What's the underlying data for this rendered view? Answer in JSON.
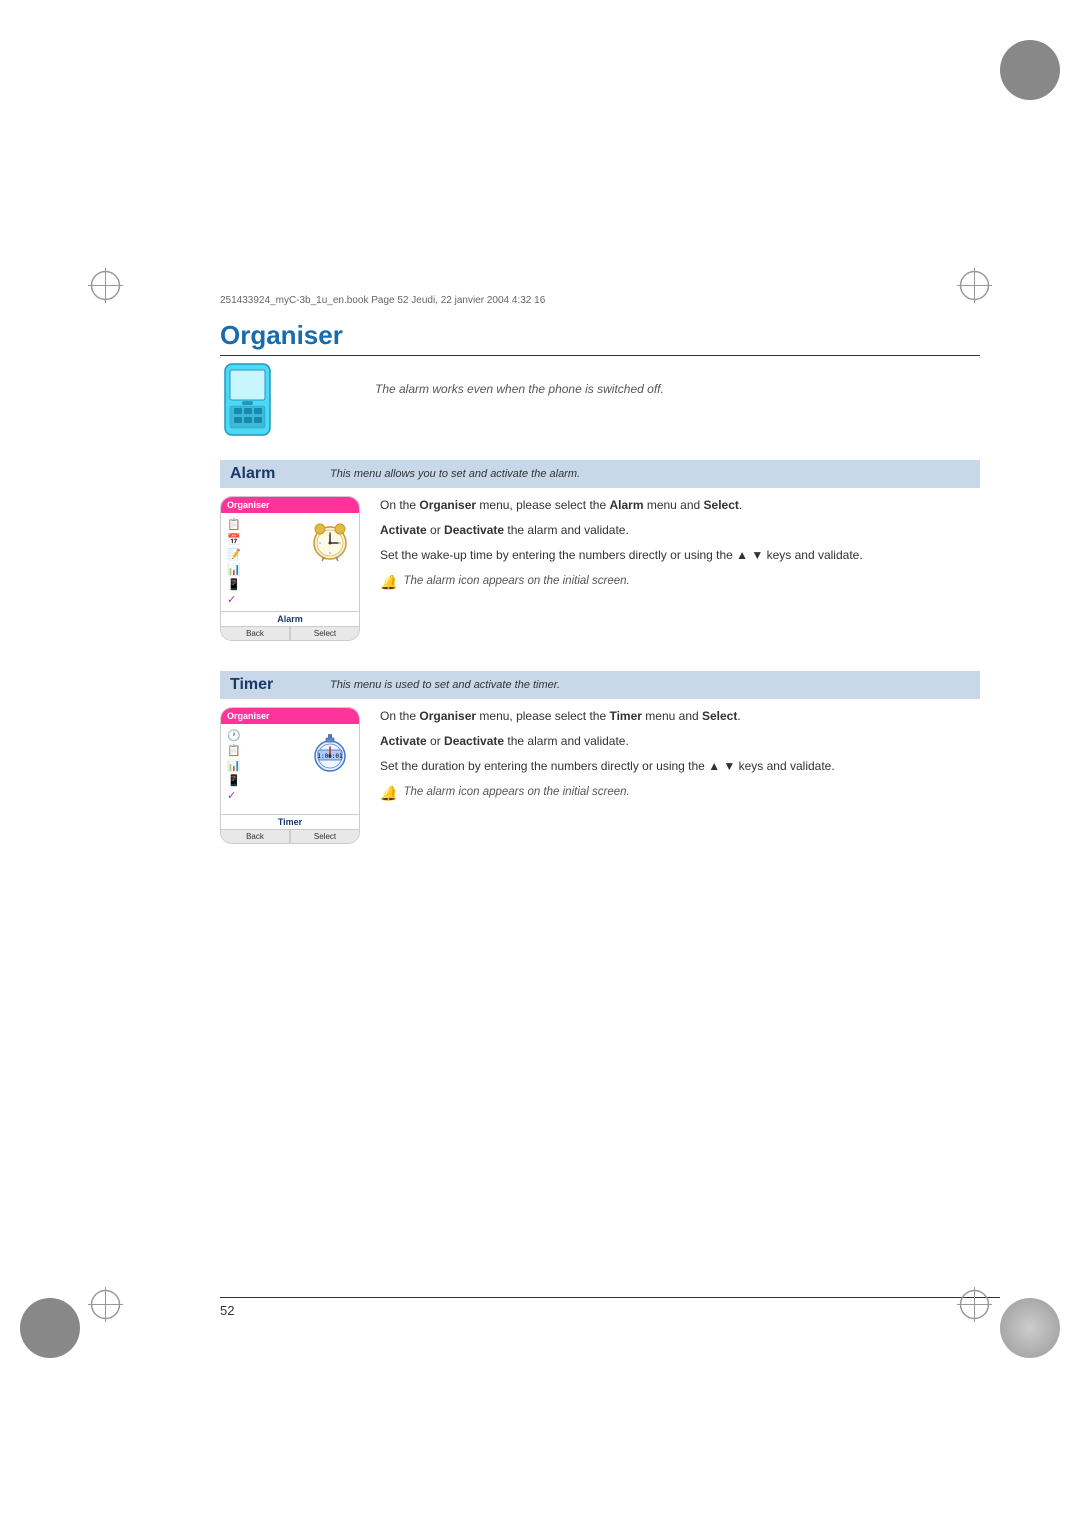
{
  "page": {
    "background": "#ffffff",
    "file_info": "251433924_myC-3b_1u_en.book  Page 52  Jeudi, 22  janvier 2004  4:32 16",
    "page_number": "52"
  },
  "title": "Organiser",
  "intro_italic": "The alarm works even when the phone is switched off.",
  "sections": [
    {
      "id": "alarm",
      "title": "Alarm",
      "subtitle": "This menu allows you to set and activate the alarm.",
      "phone_header": "Organiser",
      "phone_label": "Alarm",
      "softkey_back": "Back",
      "softkey_select": "Select",
      "description_lines": [
        "On the <b>Organiser</b> menu, please select the <b>Alarm</b> menu and <b>Select</b>.",
        "<b>Activate</b> or <b>Deactivate</b> the alarm and validate.",
        "Set the wake-up time by entering the numbers directly or using the ▲ ▼ keys and validate.",
        "note: The alarm icon appears on the initial screen."
      ]
    },
    {
      "id": "timer",
      "title": "Timer",
      "subtitle": "This menu is used to set and activate the timer.",
      "phone_header": "Organiser",
      "phone_label": "Timer",
      "softkey_back": "Back",
      "softkey_select": "Select",
      "description_lines": [
        "On the <b>Organiser</b> menu, please select the <b>Timer</b> menu and <b>Select</b>.",
        "<b>Activate</b> or <b>Deactivate</b> the alarm and validate.",
        "Set the duration by entering the numbers directly or using the ▲ ▼ keys and validate.",
        "note: The alarm icon appears on the initial screen."
      ]
    }
  ]
}
